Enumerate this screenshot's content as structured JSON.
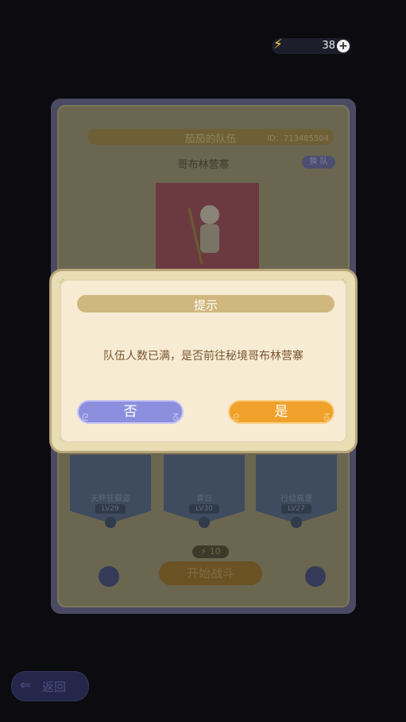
{
  "energy": {
    "value": "38",
    "bolt_icon": "lightning-icon",
    "plus_icon": "plus-icon"
  },
  "team": {
    "name": "茄茄的队伍",
    "id": "ID：713485504",
    "camp": "哥布林营寨",
    "swap_label": "换 队",
    "members": [
      {
        "name": "天秤狂霸盗",
        "level": "LV29"
      },
      {
        "name": "青日",
        "level": "LV30"
      },
      {
        "name": "行动高速",
        "level": "LV27"
      }
    ],
    "cost": "10",
    "start_label": "开始战斗"
  },
  "back_label": "返回",
  "dialog": {
    "title": "提示",
    "message": "队伍人数已满，是否前往秘境哥布林营寨",
    "no_label": "否",
    "yes_label": "是"
  },
  "colors": {
    "no_button": "#8c8fde",
    "yes_button": "#f0a12b",
    "dialog_bg": "#f7ebd4",
    "title_bar": "#cfb77d"
  }
}
